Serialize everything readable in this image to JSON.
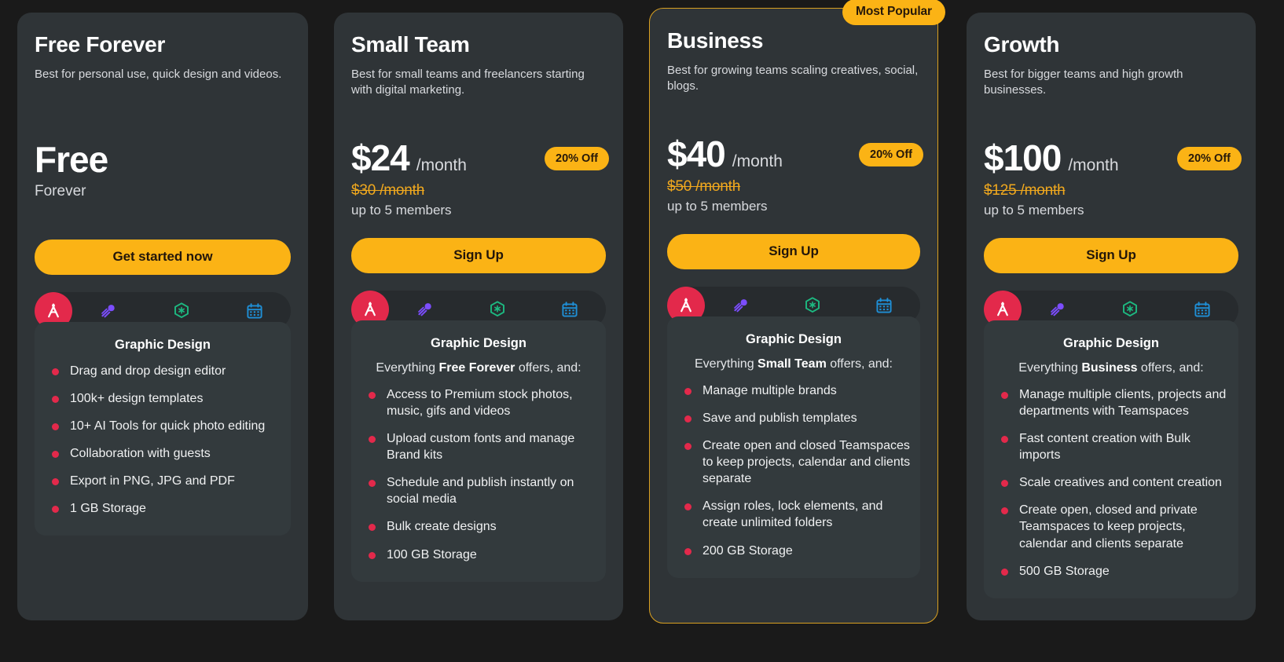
{
  "colors": {
    "page_background": "#1a1a1a",
    "card_background": "#2f3437",
    "features_panel_background": "#333a3d",
    "accent_amber": "#fbb315",
    "accent_amber_text": "#f0a81e",
    "highlight_border": "#d9a021",
    "bullet_red": "#e3294b",
    "tab_active_red": "#e3294b",
    "icon_purple": "#7c4dff",
    "icon_green": "#1db981",
    "icon_blue": "#1f8fd6"
  },
  "category_tabs": [
    {
      "name": "graphic-design",
      "icon": "compass-icon",
      "active": true
    },
    {
      "name": "magic-wand",
      "icon": "comet-wand-icon",
      "active": false
    },
    {
      "name": "video",
      "icon": "hexagon-star-icon",
      "active": false
    },
    {
      "name": "calendar",
      "icon": "calendar-icon",
      "active": false
    }
  ],
  "plans": [
    {
      "id": "free-forever",
      "name": "Free Forever",
      "tagline": "Best for personal use, quick design and videos.",
      "price_amount": "Free",
      "price_period": "",
      "price_sub": "Forever",
      "old_price": "",
      "members": "",
      "discount_badge": "",
      "popular_badge": "",
      "cta_label": "Get started now",
      "features_title": "Graphic Design",
      "features_intro_prefix": "",
      "features_intro_bold": "",
      "features_intro_suffix": "",
      "features": [
        "Drag and drop design editor",
        "100k+ design templates",
        "10+ AI Tools for quick photo editing",
        "Collaboration with guests",
        "Export in PNG, JPG and PDF",
        "1 GB Storage"
      ]
    },
    {
      "id": "small-team",
      "name": "Small Team",
      "tagline": "Best for small teams and freelancers starting with digital marketing.",
      "price_amount": "$24",
      "price_period": "/month",
      "price_sub": "",
      "old_price": "$30 /month",
      "members": "up to 5 members",
      "discount_badge": "20% Off",
      "popular_badge": "",
      "cta_label": "Sign Up",
      "features_title": "Graphic Design",
      "features_intro_prefix": "Everything ",
      "features_intro_bold": "Free Forever",
      "features_intro_suffix": " offers, and:",
      "features": [
        "Access to Premium stock photos, music, gifs and videos",
        "Upload custom fonts and manage Brand kits",
        "Schedule and publish instantly on social media",
        "Bulk create designs",
        "100 GB Storage"
      ]
    },
    {
      "id": "business",
      "name": "Business",
      "tagline": "Best for growing teams scaling creatives, social,  blogs.",
      "price_amount": "$40",
      "price_period": "/month",
      "price_sub": "",
      "old_price": "$50 /month",
      "members": "up to 5 members",
      "discount_badge": "20% Off",
      "popular_badge": "Most Popular",
      "cta_label": "Sign Up",
      "features_title": "Graphic Design",
      "features_intro_prefix": "Everything ",
      "features_intro_bold": "Small Team",
      "features_intro_suffix": " offers, and:",
      "features": [
        "Manage multiple brands",
        "Save and publish templates",
        "Create open and closed Teamspaces to keep projects, calendar and clients separate",
        "Assign roles, lock elements, and create unlimited folders",
        "200 GB Storage"
      ]
    },
    {
      "id": "growth",
      "name": "Growth",
      "tagline": "Best for bigger teams and high growth businesses.",
      "price_amount": "$100",
      "price_period": "/month",
      "price_sub": "",
      "old_price": "$125 /month",
      "members": "up to 5 members",
      "discount_badge": "20% Off",
      "popular_badge": "",
      "cta_label": "Sign Up",
      "features_title": "Graphic Design",
      "features_intro_prefix": "Everything ",
      "features_intro_bold": "Business",
      "features_intro_suffix": " offers, and:",
      "features": [
        "Manage multiple clients, projects and departments with Teamspaces",
        "Fast content creation with Bulk imports",
        "Scale creatives and content creation",
        "Create open, closed and private Teamspaces to keep projects, calendar and clients separate",
        "500 GB Storage"
      ]
    }
  ]
}
